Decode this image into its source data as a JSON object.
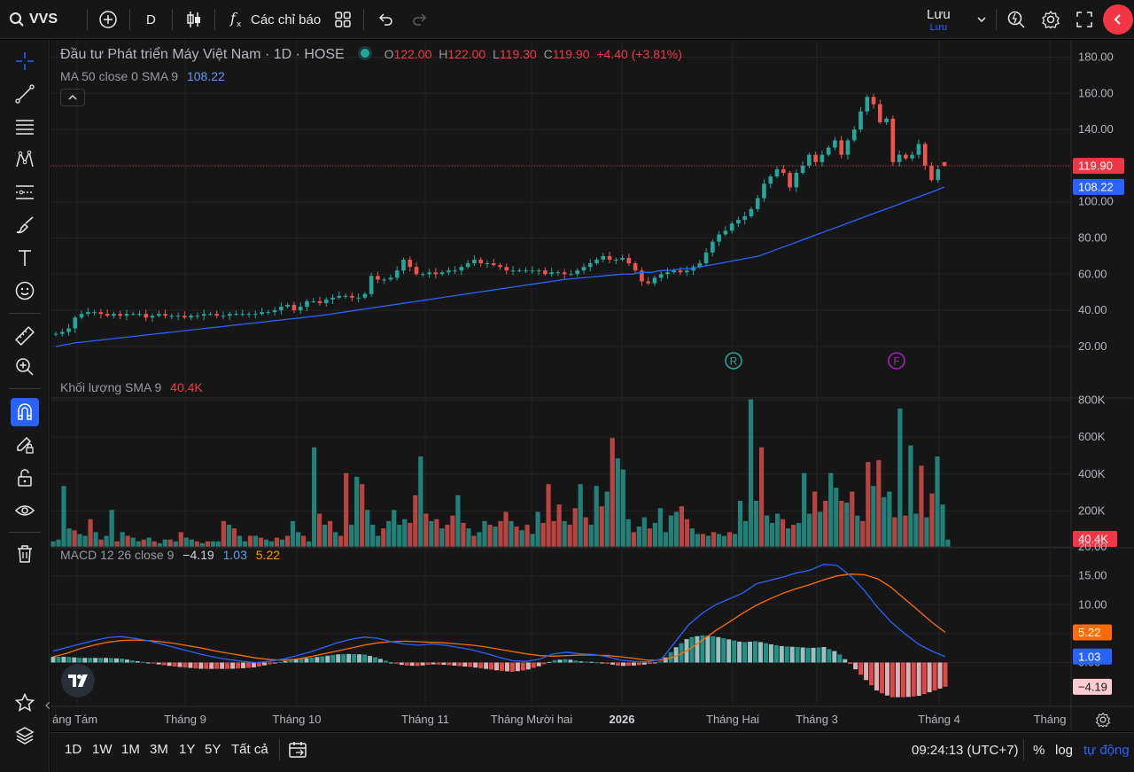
{
  "toolbar": {
    "symbol": "VVS",
    "interval": "D",
    "indicators_label": "Các chỉ báo",
    "save_label": "Lưu",
    "save_sub": "Lưu"
  },
  "legend": {
    "title": "Đầu tư Phát triển Máy Việt Nam · 1D · HOSE",
    "o_label": "O",
    "o_value": "122.00",
    "h_label": "H",
    "h_value": "122.00",
    "l_label": "L",
    "l_value": "119.30",
    "c_label": "C",
    "c_value": "119.90",
    "change": "+4.40 (+3.81%)",
    "ma_label": "MA 50 close 0 SMA 9",
    "ma_value": "108.22",
    "vol_label": "Khối lượng SMA 9",
    "vol_value": "40.4K",
    "macd_label": "MACD 12 26 close 9",
    "macd_hist": "−4.19",
    "macd_line": "1.03",
    "macd_signal": "5.22"
  },
  "price_axis": {
    "ticks": [
      "180.00",
      "160.00",
      "140.00",
      "120.00",
      "100.00",
      "80.00",
      "60.00",
      "40.00",
      "20.00"
    ],
    "last_price": "119.90",
    "ma_price": "108.22"
  },
  "volume_axis": {
    "ticks": [
      "800K",
      "600K",
      "400K",
      "200K"
    ],
    "last_volume": "40.4K"
  },
  "macd_axis": {
    "ticks": [
      "20.00",
      "15.00",
      "10.00",
      "5.00",
      "0.00"
    ],
    "signal_label": "5.22",
    "macd_label": "1.03",
    "hist_label": "−4.19"
  },
  "time_axis": {
    "labels": [
      "áng Tám",
      "Tháng 9",
      "Tháng 10",
      "Tháng 11",
      "Tháng Mười hai",
      "2026",
      "Tháng Hai",
      "Tháng 3",
      "Tháng 4",
      "Tháng"
    ]
  },
  "markers": [
    "R",
    "F"
  ],
  "bottom": {
    "ranges": [
      "1D",
      "1W",
      "1M",
      "3M",
      "1Y",
      "5Y",
      "Tất cả"
    ],
    "clock": "09:24:13 (UTC+7)",
    "percent": "%",
    "log": "log",
    "auto": "tự động"
  },
  "colors": {
    "up": "#26a69a",
    "down": "#ef5350",
    "ma": "#2962ff",
    "macd": "#2962ff",
    "signal": "#ff6d00",
    "accent": "#2962ff",
    "close_button": "#f23645"
  },
  "chart_data": [
    {
      "type": "candlestick",
      "title": "Đầu tư Phát triển Máy Việt Nam · 1D · HOSE",
      "ylim": [
        10,
        185
      ],
      "x_labels": [
        "Tháng Tám",
        "Tháng 9",
        "Tháng 10",
        "Tháng 11",
        "Tháng Mười hai",
        "2026",
        "Tháng Hai",
        "Tháng 3",
        "Tháng 4"
      ],
      "close": [
        27,
        28,
        30,
        36,
        38,
        39,
        39,
        38,
        37,
        38,
        37,
        38,
        38,
        38,
        36,
        37,
        38,
        37,
        37,
        37,
        36,
        37,
        37,
        38,
        38,
        37,
        37,
        38,
        38,
        38,
        38,
        38,
        39,
        39,
        40,
        42,
        43,
        40,
        42,
        45,
        45,
        44,
        46,
        47,
        48,
        48,
        47,
        47,
        49,
        59,
        57,
        57,
        58,
        62,
        68,
        64,
        60,
        60,
        61,
        60,
        61,
        62,
        62,
        64,
        66,
        68,
        66,
        66,
        65,
        64,
        62,
        62,
        62,
        62,
        62,
        62,
        60,
        61,
        61,
        60,
        60,
        62,
        64,
        66,
        68,
        70,
        68,
        68,
        69,
        66,
        62,
        56,
        55,
        58,
        60,
        61,
        62,
        61,
        62,
        64,
        66,
        72,
        78,
        82,
        84,
        88,
        90,
        92,
        96,
        102,
        110,
        114,
        118,
        116,
        108,
        116,
        120,
        126,
        122,
        126,
        130,
        134,
        126,
        134,
        140,
        150,
        158,
        154,
        144,
        146,
        122,
        126,
        124,
        126,
        132,
        120,
        112,
        118,
        119.9
      ],
      "ma50": [
        20,
        21,
        22,
        22.6,
        23.2,
        23.8,
        24.4,
        25,
        25.6,
        26.2,
        26.8,
        27.4,
        28,
        28.6,
        29.2,
        29.8,
        30.4,
        31,
        31.6,
        32.2,
        32.8,
        33.4,
        34,
        34.6,
        35.2,
        35.8,
        36.4,
        37,
        37.8,
        38.6,
        39.4,
        40.2,
        41,
        41.8,
        42.6,
        43.4,
        44.2,
        45,
        45.8,
        46.6,
        47.4,
        48.2,
        49,
        49.8,
        50.6,
        51.4,
        52.2,
        53,
        53.8,
        54.6,
        55.4,
        56.2,
        57,
        57.5,
        58,
        58.5,
        59,
        59.5,
        60,
        60,
        61,
        61,
        62,
        62,
        63,
        63,
        64,
        65,
        66,
        67,
        68,
        69,
        70,
        72,
        74,
        76,
        78,
        80,
        82,
        84,
        86,
        88,
        90,
        92,
        94,
        96,
        98,
        100,
        102,
        104,
        106,
        108.22
      ],
      "ma50_last": 108.22,
      "last": {
        "open": 122.0,
        "high": 122.0,
        "low": 119.3,
        "close": 119.9,
        "change": 4.4,
        "change_pct": 3.81
      }
    },
    {
      "type": "bar",
      "title": "Khối lượng SMA 9",
      "ylim": [
        0,
        880000
      ],
      "values": [
        30,
        40,
        330,
        100,
        90,
        70,
        60,
        150,
        80,
        40,
        60,
        200,
        30,
        80,
        60,
        50,
        30,
        40,
        50,
        30,
        20,
        40,
        40,
        30,
        80,
        50,
        40,
        30,
        20,
        30,
        30,
        30,
        140,
        120,
        100,
        60,
        30,
        60,
        60,
        50,
        40,
        30,
        50,
        40,
        60,
        140,
        80,
        60,
        30,
        540,
        180,
        120,
        140,
        80,
        60,
        400,
        120,
        380,
        340,
        200,
        120,
        60,
        100,
        140,
        200,
        120,
        150,
        130,
        280,
        490,
        180,
        140,
        150,
        100,
        120,
        170,
        280,
        130,
        100,
        60,
        80,
        140,
        120,
        110,
        140,
        190,
        140,
        110,
        90,
        120,
        70,
        190,
        130,
        340,
        140,
        230,
        140,
        120,
        210,
        340,
        160,
        120,
        330,
        220,
        300,
        590,
        480,
        420,
        150,
        80,
        110,
        160,
        100,
        130,
        210,
        80,
        170,
        190,
        220,
        150,
        100,
        70,
        70,
        60,
        80,
        70,
        60,
        80,
        70,
        250,
        140,
        800,
        250,
        540,
        170,
        130,
        180,
        150,
        100,
        120,
        130,
        400,
        180,
        300,
        190,
        250,
        400,
        320,
        250,
        240,
        300,
        170,
        140,
        460,
        330,
        470,
        270,
        300,
        160,
        750,
        170,
        550,
        180,
        440,
        160,
        290,
        490,
        230,
        40
      ],
      "unit": "thousand shares",
      "last": 40400
    },
    {
      "type": "line",
      "title": "MACD 12 26 close 9",
      "ylim": [
        -5,
        21
      ],
      "macd": [
        2,
        2.6,
        3.2,
        3.8,
        4.3,
        4.5,
        4.2,
        3.8,
        3.2,
        2.6,
        2,
        1.4,
        0.9,
        0.5,
        0.2,
        0,
        0.2,
        0.6,
        1.2,
        1.8,
        2.6,
        3.4,
        4,
        4.4,
        4.2,
        3.6,
        3.2,
        3,
        3.2,
        3,
        2.6,
        2.2,
        1.6,
        0.9,
        0.3,
        0.2,
        0.6,
        1.5,
        1.8,
        1.5,
        1.4,
        1,
        0.4,
        0.2,
        0.1,
        0.6,
        3.5,
        6.5,
        8.5,
        10,
        11,
        12,
        13.6,
        14.2,
        14.8,
        15.5,
        16,
        17,
        16.8,
        15,
        12.5,
        9.5,
        7,
        5,
        3.2,
        2,
        1.03
      ],
      "signal": [
        1,
        1.6,
        2.4,
        3,
        3.5,
        3.8,
        3.9,
        3.8,
        3.6,
        3.3,
        2.9,
        2.5,
        2,
        1.6,
        1.2,
        0.8,
        0.5,
        0.4,
        0.6,
        1,
        1.5,
        2,
        2.5,
        3,
        3.4,
        3.6,
        3.7,
        3.6,
        3.5,
        3.4,
        3.2,
        3,
        2.7,
        2.3,
        1.9,
        1.5,
        1.2,
        1.1,
        1.2,
        1.3,
        1.3,
        1.2,
        1,
        0.7,
        0.4,
        0.4,
        1,
        2.2,
        3.8,
        5.5,
        7,
        8.5,
        9.9,
        11,
        12,
        12.8,
        13.5,
        14.3,
        15,
        15.3,
        15.2,
        14.5,
        13,
        11,
        9,
        7,
        5.22
      ],
      "histogram_last": -4.19,
      "macd_last": 1.03,
      "signal_last": 5.22
    }
  ]
}
